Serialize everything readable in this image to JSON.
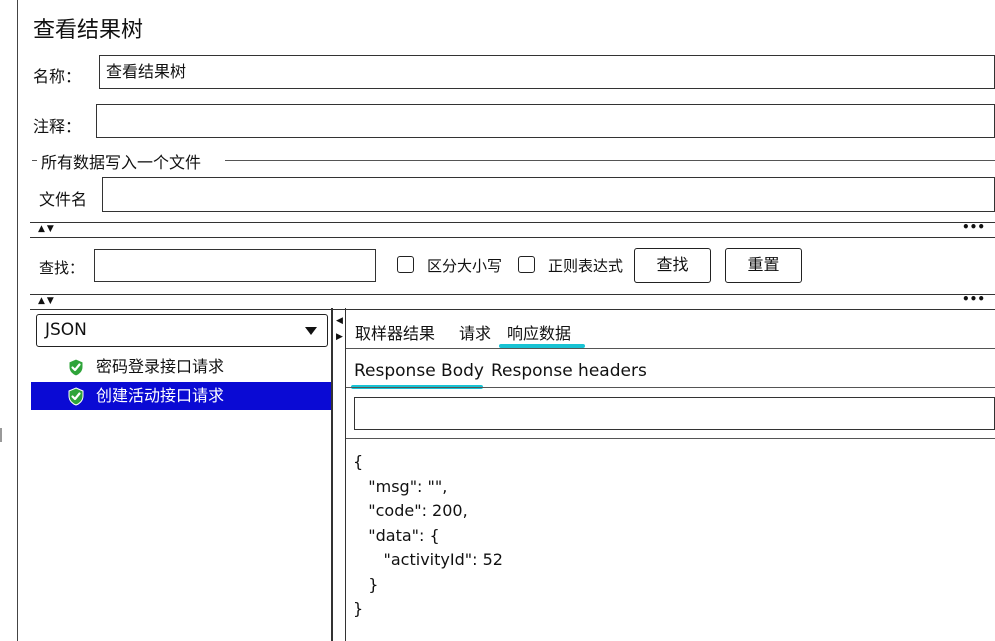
{
  "title": "查看结果树",
  "name_label": "名称：",
  "name_value": "查看结果树",
  "comment_label": "注释：",
  "comment_value": "",
  "file_group_label": "所有数据写入一个文件",
  "filename_label": "文件名",
  "filename_value": "",
  "search": {
    "label": "查找：",
    "value": "",
    "case_label": "区分大小写",
    "regex_label": "正则表达式",
    "find_button": "查找",
    "reset_button": "重置"
  },
  "split_arrows": "▲▼",
  "split_dots": "•••",
  "renderer": "JSON",
  "tree": [
    {
      "label": "密码登录接口请求",
      "selected": false,
      "icon": "green-shield-check-icon"
    },
    {
      "label": "创建活动接口请求",
      "selected": true,
      "icon": "green-shield-check-icon"
    }
  ],
  "tabs": [
    "取样器结果",
    "请求",
    "响应数据"
  ],
  "active_tab": "响应数据",
  "subtabs": [
    "Response Body",
    "Response headers"
  ],
  "active_subtab": "Response Body",
  "response_search_value": "",
  "response_body": "{\n   \"msg\": \"\",\n   \"code\": 200,\n   \"data\": {\n      \"activityId\": 52\n   }\n}",
  "colors": {
    "selection": "#0a0ad4",
    "tab_accent": "#18c3d4",
    "icon_green": "#2fa43a"
  }
}
